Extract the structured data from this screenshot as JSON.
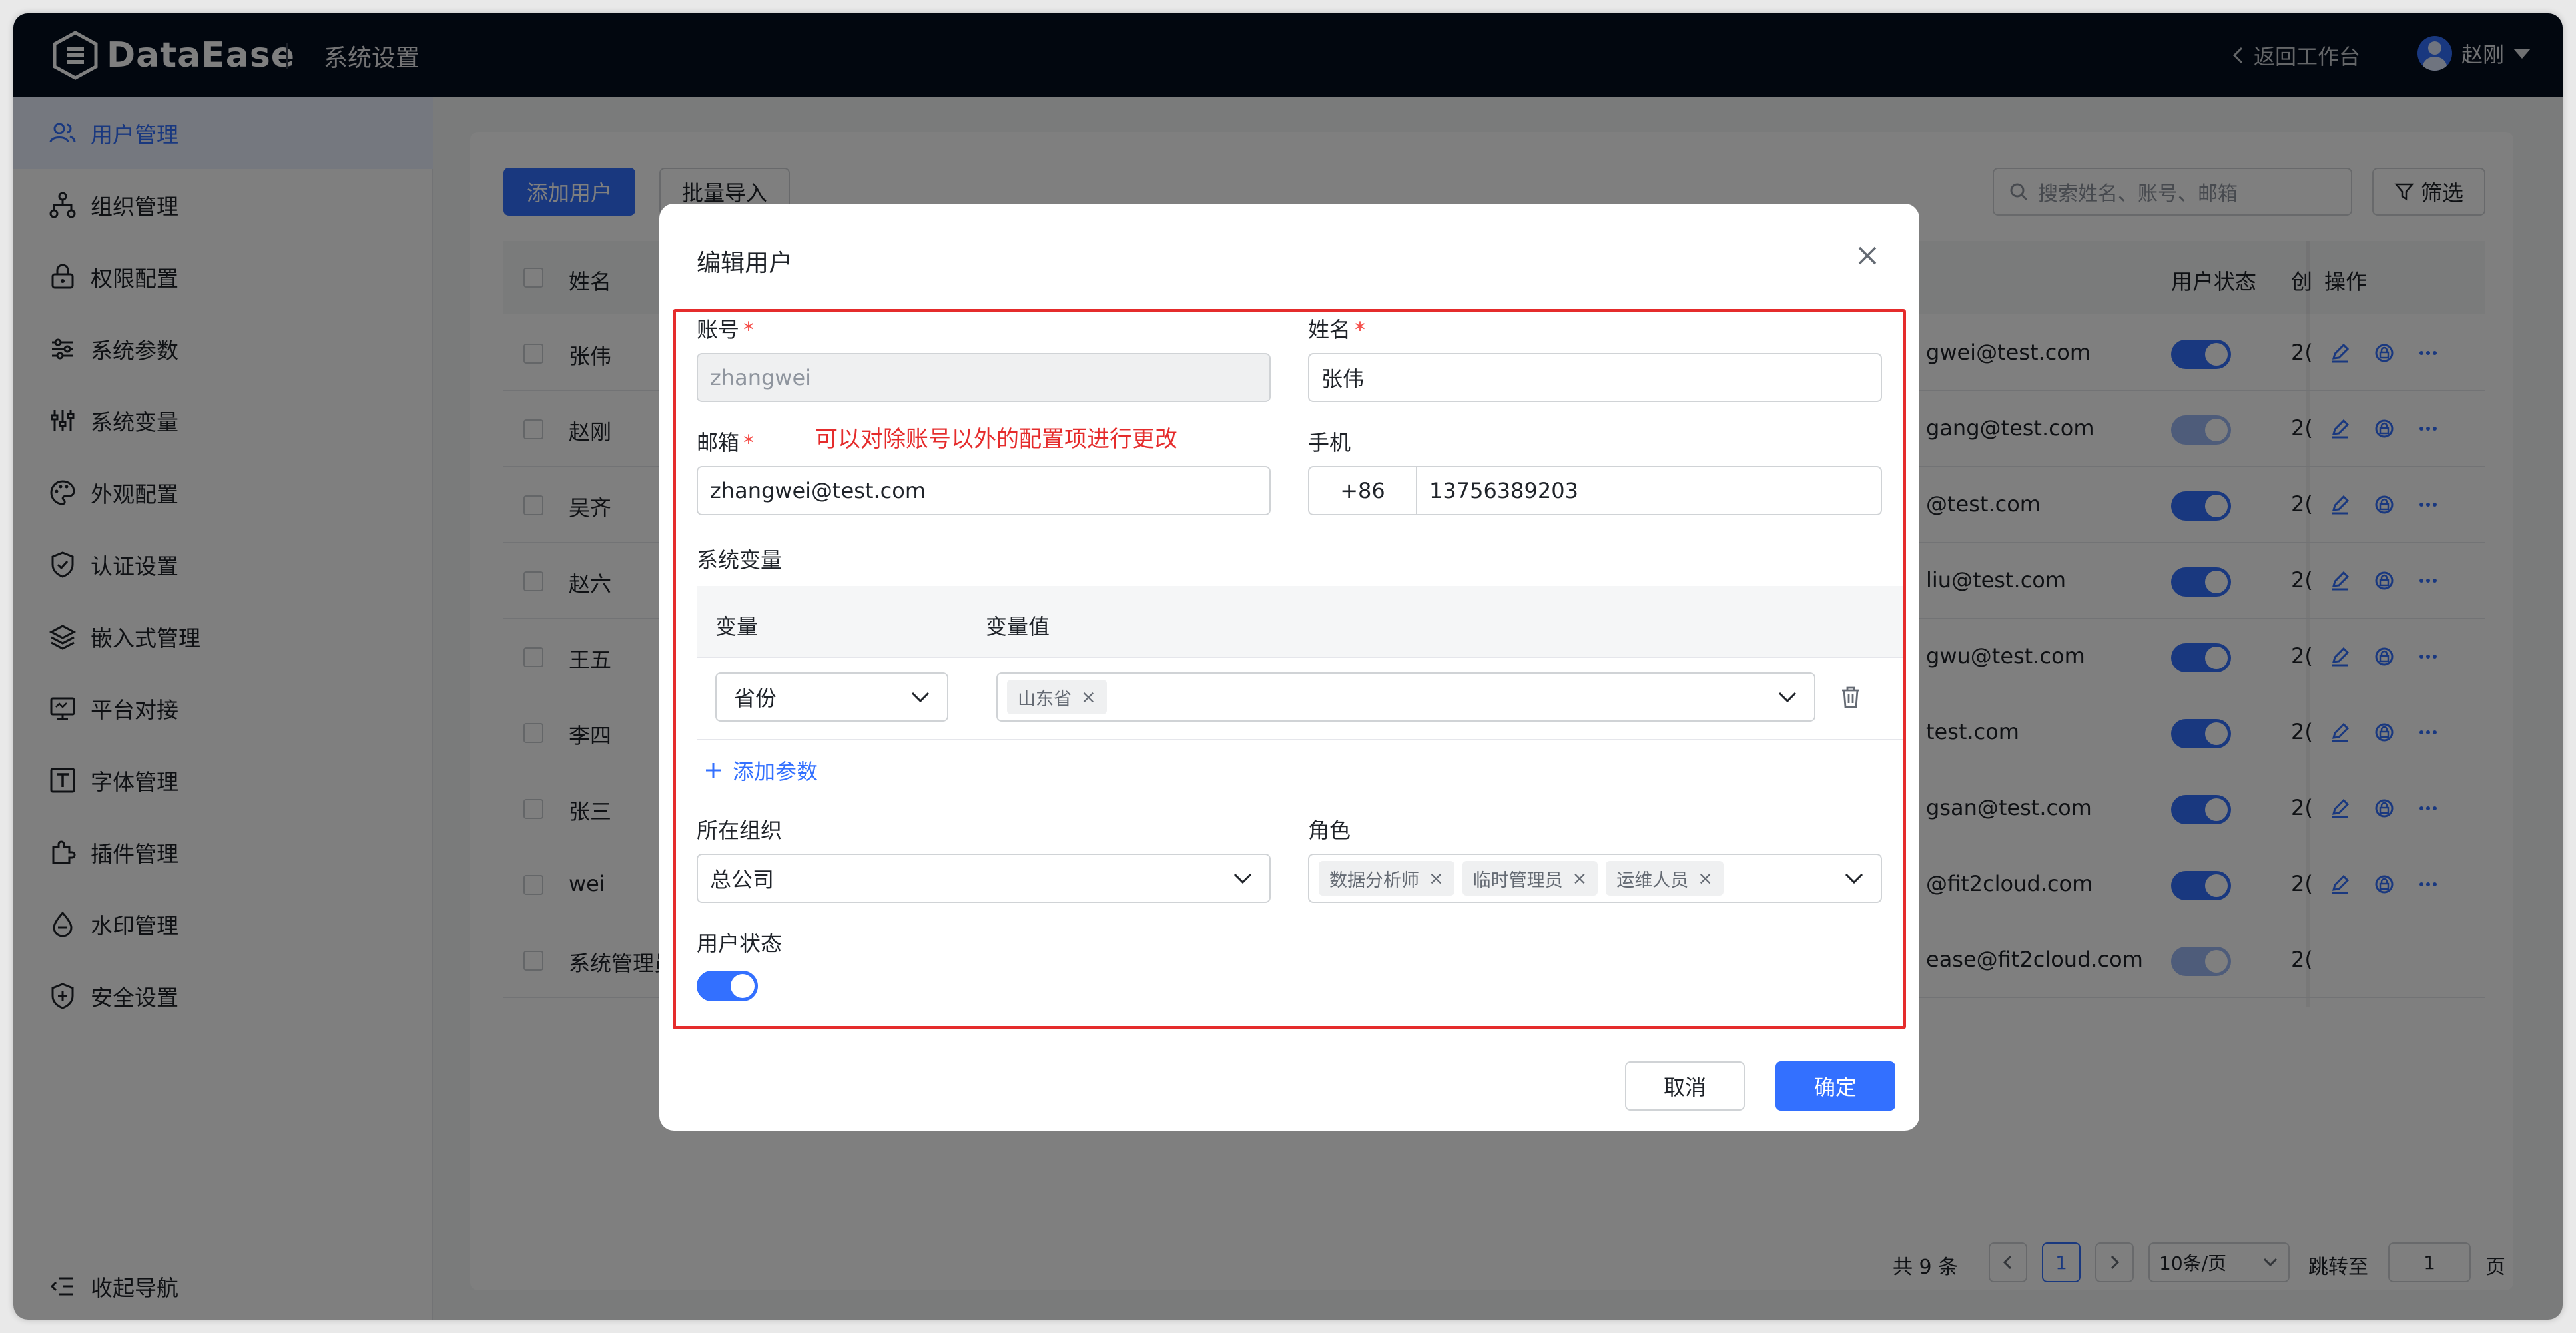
{
  "header": {
    "logo_text": "DataEase",
    "system_title": "系统设置",
    "back_label": "返回工作台",
    "user_name": "赵刚"
  },
  "sidebar": {
    "items": [
      {
        "label": "用户管理",
        "icon": "users-icon",
        "active": true
      },
      {
        "label": "组织管理",
        "icon": "org-tree-icon"
      },
      {
        "label": "权限配置",
        "icon": "lock-icon"
      },
      {
        "label": "系统参数",
        "icon": "sliders-icon"
      },
      {
        "label": "系统变量",
        "icon": "variables-icon"
      },
      {
        "label": "外观配置",
        "icon": "palette-icon"
      },
      {
        "label": "认证设置",
        "icon": "shield-check-icon"
      },
      {
        "label": "嵌入式管理",
        "icon": "layers-icon"
      },
      {
        "label": "平台对接",
        "icon": "monitor-icon"
      },
      {
        "label": "字体管理",
        "icon": "font-icon"
      },
      {
        "label": "插件管理",
        "icon": "plugin-icon"
      },
      {
        "label": "水印管理",
        "icon": "droplet-icon"
      },
      {
        "label": "安全设置",
        "icon": "shield-plus-icon"
      }
    ],
    "collapse_label": "收起导航"
  },
  "toolbar": {
    "add_user": "添加用户",
    "batch_import": "批量导入",
    "search_placeholder": "搜索姓名、账号、邮箱",
    "filter": "筛选"
  },
  "table": {
    "columns": {
      "name": "姓名",
      "status": "用户状态",
      "created_partial": "创",
      "ops": "操作"
    },
    "rows": [
      {
        "name": "张伟",
        "email_tail": "gwei@test.com",
        "date": "2(",
        "enabled": true
      },
      {
        "name": "赵刚",
        "email_tail": "gang@test.com",
        "date": "2(",
        "enabled": true,
        "dim": true
      },
      {
        "name": "吴齐",
        "email_tail": "@test.com",
        "date": "2(",
        "enabled": true
      },
      {
        "name": "赵六",
        "email_tail": "liu@test.com",
        "date": "2(",
        "enabled": true
      },
      {
        "name": "王五",
        "email_tail": "gwu@test.com",
        "date": "2(",
        "enabled": true
      },
      {
        "name": "李四",
        "email_tail": "test.com",
        "date": "2(",
        "enabled": true
      },
      {
        "name": "张三",
        "email_tail": "gsan@test.com",
        "date": "2(",
        "enabled": true
      },
      {
        "name": "wei",
        "email_tail": "@fit2cloud.com",
        "date": "2(",
        "enabled": true
      },
      {
        "name": "系统管理员",
        "email_tail": "ease@fit2cloud.com",
        "date": "2(",
        "enabled": true,
        "dim": true
      }
    ]
  },
  "pagination": {
    "total": "共 9 条",
    "current_page": "1",
    "page_size": "10条/页",
    "jump_label": "跳转至",
    "jump_value": "1",
    "page_suffix": "页"
  },
  "dialog": {
    "title": "编辑用户",
    "annotation": "可以对除账号以外的配置项进行更改",
    "account": {
      "label": "账号",
      "value": "zhangwei"
    },
    "name": {
      "label": "姓名",
      "value": "张伟"
    },
    "email": {
      "label": "邮箱",
      "value": "zhangwei@test.com"
    },
    "phone": {
      "label": "手机",
      "prefix": "+86",
      "value": "13756389203"
    },
    "sys_var": {
      "label": "系统变量",
      "col_var": "变量",
      "col_value": "变量值",
      "row": {
        "variable": "省份",
        "tags": [
          "山东省"
        ]
      },
      "add_param": "添加参数"
    },
    "org": {
      "label": "所在组织",
      "value": "总公司"
    },
    "role": {
      "label": "角色",
      "tags": [
        "数据分析师",
        "临时管理员",
        "运维人员"
      ]
    },
    "status": {
      "label": "用户状态",
      "enabled": true
    },
    "cancel": "取消",
    "confirm": "确定"
  },
  "colors": {
    "primary": "#3370ff",
    "header_bg": "#050e1f",
    "annotation_red": "#e52c2c"
  }
}
